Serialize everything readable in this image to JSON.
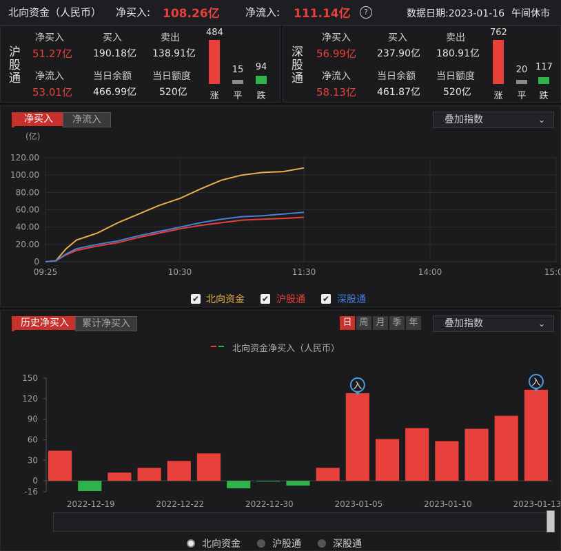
{
  "header": {
    "title": "北向资金（人民币）",
    "net_buy_label": "净买入:",
    "net_buy_value": "108.26亿",
    "net_inflow_label": "净流入:",
    "net_inflow_value": "111.14亿",
    "help_icon": "question-circle-icon",
    "date_label": "数据日期:2023-01-16",
    "status": "午间休市"
  },
  "hgt": {
    "name": "沪股通",
    "net_buy_label": "净买入",
    "net_buy_value": "51.27亿",
    "buy_label": "买入",
    "buy_value": "190.18亿",
    "sell_label": "卖出",
    "sell_value": "138.91亿",
    "net_inflow_label": "净流入",
    "net_inflow_value": "53.01亿",
    "balance_label": "当日余额",
    "balance_value": "466.99亿",
    "quota_label": "当日额度",
    "quota_value": "520亿",
    "up_count": 484,
    "flat_count": 15,
    "down_count": 94,
    "up_label": "涨",
    "flat_label": "平",
    "down_label": "跌"
  },
  "sgt": {
    "name": "深股通",
    "net_buy_label": "净买入",
    "net_buy_value": "56.99亿",
    "buy_label": "买入",
    "buy_value": "237.90亿",
    "sell_label": "卖出",
    "sell_value": "180.91亿",
    "net_inflow_label": "净流入",
    "net_inflow_value": "58.13亿",
    "balance_label": "当日余额",
    "balance_value": "461.87亿",
    "quota_label": "当日额度",
    "quota_value": "520亿",
    "up_count": 762,
    "flat_count": 20,
    "down_count": 117,
    "up_label": "涨",
    "flat_label": "平",
    "down_label": "跌"
  },
  "intraday": {
    "tabs": [
      "净买入",
      "净流入"
    ],
    "active_tab": 0,
    "overlay_label": "叠加指数",
    "legend": [
      {
        "label": "北向资金",
        "checked": true
      },
      {
        "label": "沪股通",
        "checked": true
      },
      {
        "label": "深股通",
        "checked": true
      }
    ]
  },
  "history": {
    "tabs": [
      "历史净买入",
      "累计净买入"
    ],
    "active_tab": 0,
    "periods": [
      "日",
      "周",
      "月",
      "季",
      "年"
    ],
    "active_period": 0,
    "overlay_label": "叠加指数",
    "series_legend": "北向资金净买入（人民币）",
    "marker_label": "入",
    "bottom_legend": [
      "北向资金",
      "沪股通",
      "深股通"
    ],
    "bottom_selected": 0
  },
  "colors": {
    "north": "#e8b04a",
    "hgt": "#e8403a",
    "sgt": "#4a7fd8",
    "up_bar": "#e8403a",
    "down_bar": "#2fb24c",
    "flat_bar": "#8a8a8a",
    "marker": "#4a9be0"
  },
  "chart_data": [
    {
      "type": "line",
      "ylabel": "(亿)",
      "ylim": [
        0,
        120
      ],
      "yticks": [
        "0",
        "20.00",
        "40.00",
        "60.00",
        "80.00",
        "100.00",
        "120.00"
      ],
      "xticks": [
        "09:25",
        "10:30",
        "11:30",
        "14:00",
        "15:00"
      ],
      "grid": true,
      "series": [
        {
          "name": "北向资金",
          "x": [
            "09:25",
            "09:30",
            "09:35",
            "09:40",
            "09:50",
            "10:00",
            "10:10",
            "10:20",
            "10:30",
            "10:40",
            "10:50",
            "11:00",
            "11:10",
            "11:20",
            "11:30"
          ],
          "values": [
            0,
            1,
            15,
            25,
            33,
            45,
            55,
            65,
            73,
            84,
            94,
            100,
            103,
            104,
            108.26
          ]
        },
        {
          "name": "沪股通",
          "x": [
            "09:25",
            "09:30",
            "09:35",
            "09:40",
            "09:50",
            "10:00",
            "10:10",
            "10:20",
            "10:30",
            "10:40",
            "10:50",
            "11:00",
            "11:10",
            "11:20",
            "11:30"
          ],
          "values": [
            0,
            1,
            8,
            13,
            18,
            22,
            28,
            33,
            38,
            42,
            45,
            48,
            49,
            50,
            51.27
          ]
        },
        {
          "name": "深股通",
          "x": [
            "09:25",
            "09:30",
            "09:35",
            "09:40",
            "09:50",
            "10:00",
            "10:10",
            "10:20",
            "10:30",
            "10:40",
            "10:50",
            "11:00",
            "11:10",
            "11:20",
            "11:30"
          ],
          "values": [
            0,
            1,
            9,
            15,
            20,
            24,
            30,
            35,
            40,
            45,
            49,
            52,
            53,
            55,
            56.99
          ]
        }
      ]
    },
    {
      "type": "bar",
      "ylim": [
        -16,
        150
      ],
      "yticks": [
        "-16",
        "0",
        "30",
        "60",
        "90",
        "120",
        "150"
      ],
      "xticks": [
        "2022-12-19",
        "2022-12-22",
        "2022-12-30",
        "2023-01-05",
        "2023-01-10",
        "2023-01-13"
      ],
      "series": [
        {
          "name": "北向资金净买入（人民币）",
          "values": [
            44,
            -15,
            12,
            19,
            29,
            40,
            -11,
            -1,
            -7,
            19,
            128,
            61,
            77,
            58,
            76,
            95,
            133
          ],
          "markers": [
            10,
            16
          ]
        }
      ]
    }
  ]
}
